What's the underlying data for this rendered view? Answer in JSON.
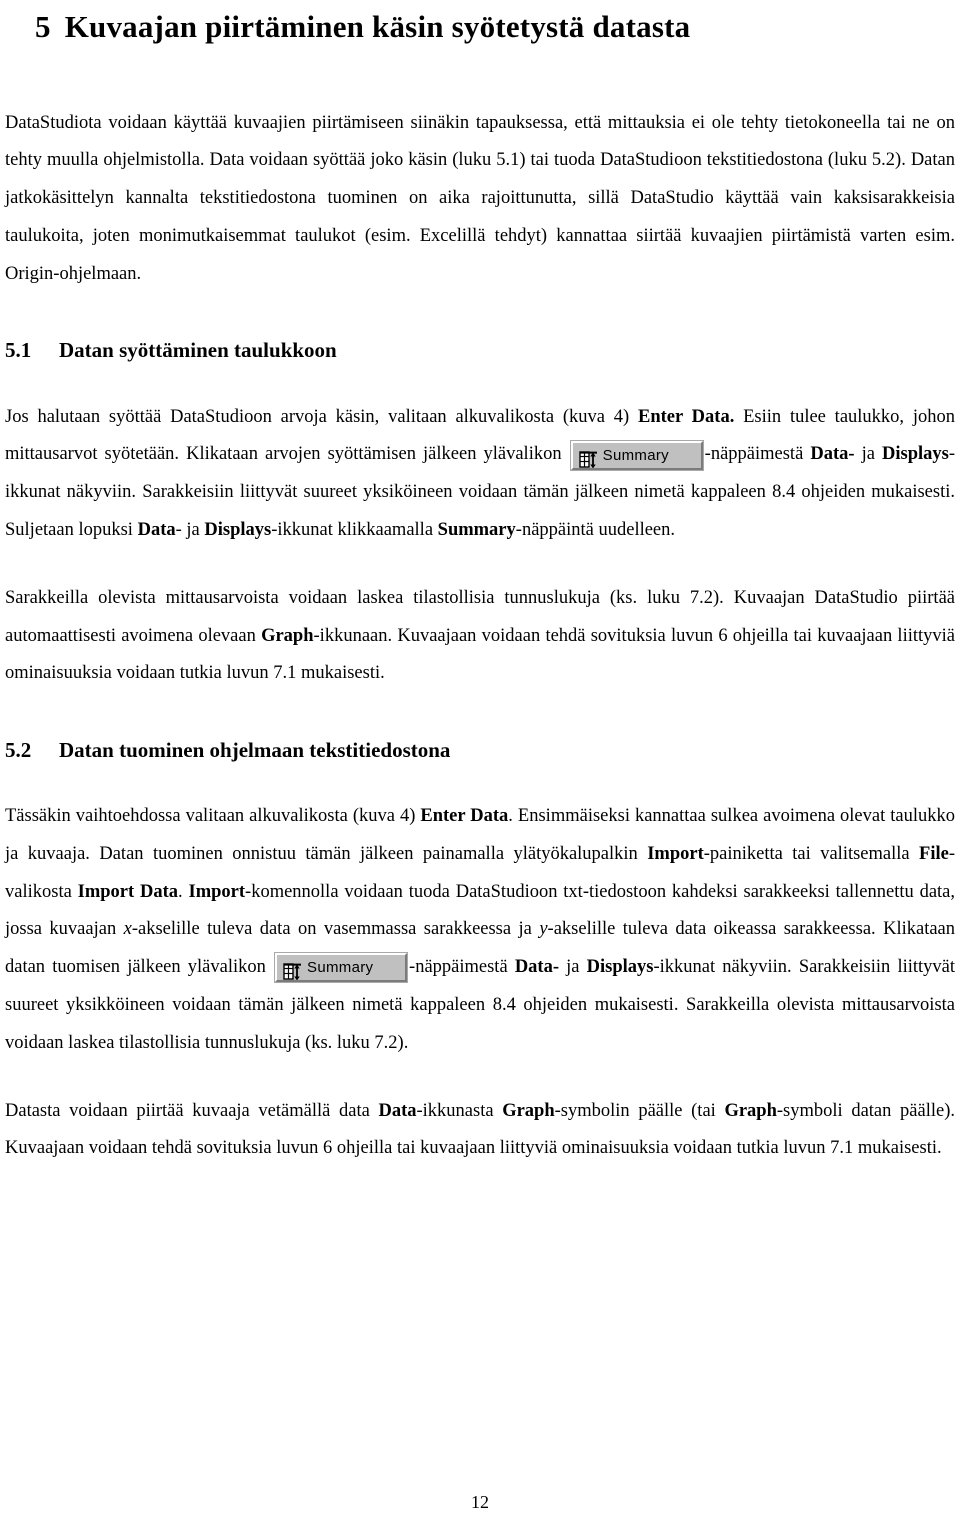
{
  "document": {
    "title": {
      "number": "5",
      "text": "Kuvaajan piirtäminen käsin syötetystä datasta"
    },
    "page_number": "12",
    "intro": {
      "p1_a": "DataStudiota voidaan käyttää kuvaajien piirtämiseen siinäkin tapauksessa, että mittauksia ei ole tehty tietokoneella tai ne on tehty muulla ohjelmistolla. Data voidaan syöttää joko käsin (luku 5.1) tai tuoda DataStudioon tekstitiedostona (luku 5.2). Datan jatkokäsittelyn kannalta tekstitiedostona tuominen on aika rajoittunutta, sillä DataStudio käyttää vain kaksisarakkeisia taulukoita, joten monimutkaisemmat taulukot (esim. Excelillä tehdyt) kannattaa siirtää kuvaajien piirtämistä varten esim. Origin-ohjelmaan."
    },
    "section_51": {
      "number": "5.1",
      "heading": "Datan syöttäminen taulukkoon",
      "p1_seg1": "Jos halutaan syöttää DataStudioon arvoja käsin, valitaan alkuvalikosta (kuva 4) ",
      "p1_bold1": "Enter Data.",
      "p1_seg2": " Esiin tulee taulukko, johon mittausarvot syötetään. Klikataan arvojen syöttämisen jälkeen ylävalikon ",
      "p1_seg3": "-näppäimestä ",
      "p1_bold2": "Data-",
      "p1_seg4": " ja ",
      "p1_bold3": "Displays",
      "p1_seg5": "-ikkunat näkyviin. Sarakkeisiin liittyvät suureet yksiköineen voidaan tämän jälkeen nimetä kappaleen 8.4 ohjeiden mukaisesti. Suljetaan lopuksi ",
      "p1_bold4": "Data",
      "p1_seg6": "- ja ",
      "p1_bold5": "Displays",
      "p1_seg7": "-ikkunat klikkaamalla ",
      "p1_bold6": "Summary",
      "p1_seg8": "-näppäintä uudelleen.",
      "p2_seg1": "Sarakkeilla olevista mittausarvoista voidaan laskea tilastollisia tunnuslukuja (ks. luku 7.2). Kuvaajan DataStudio piirtää automaattisesti avoimena olevaan ",
      "p2_bold1": "Graph",
      "p2_seg2": "-ikkunaan. Kuvaajaan voidaan tehdä sovituksia luvun 6 ohjeilla tai kuvaajaan liittyviä ominaisuuksia voidaan tutkia luvun 7.1 mukaisesti."
    },
    "section_52": {
      "number": "5.2",
      "heading": "Datan tuominen ohjelmaan tekstitiedostona",
      "p1_seg1": "Tässäkin vaihtoehdossa valitaan alkuvalikosta (kuva 4) ",
      "p1_bold1": "Enter Data",
      "p1_seg2": ". Ensimmäiseksi kannattaa sulkea avoimena olevat taulukko ja kuvaaja. Datan tuominen onnistuu tämän jälkeen painamalla ylätyökalupalkin ",
      "p1_bold2": "Import",
      "p1_seg3": "-painiketta tai valitsemalla ",
      "p1_bold3": "File",
      "p1_seg4": "-valikosta ",
      "p1_bold4": "Import Data",
      "p1_seg5": ". ",
      "p1_bold5": "Import",
      "p1_seg6": "-komennolla voidaan tuoda DataStudioon txt-tiedostoon kahdeksi sarakkeeksi tallennettu data, jossa kuvaajan ",
      "p1_italic1": "x",
      "p1_seg7": "-akselille tuleva data on vasemmassa sarakkeessa ja ",
      "p1_italic2": "y",
      "p1_seg8": "-akselille tuleva data oikeassa sarakkeessa. Klikataan datan tuomisen jälkeen ylävalikon ",
      "p1_seg9": "-näppäimestä ",
      "p1_bold6": "Data-",
      "p1_seg10": " ja ",
      "p1_bold7": "Displays",
      "p1_seg11": "-ikkunat näkyviin. Sarakkeisiin liittyvät suureet yksikköineen voidaan tämän jälkeen nimetä kappaleen 8.4 ohjeiden mukaisesti. Sarakkeilla olevista mittausarvoista voidaan laskea tilastollisia tunnuslukuja (ks. luku 7.2).",
      "p2_seg1": "Datasta voidaan piirtää kuvaaja vetämällä data ",
      "p2_bold1": "Data",
      "p2_seg2": "-ikkunasta ",
      "p2_bold2": "Graph",
      "p2_seg3": "-symbolin päälle (tai ",
      "p2_bold3": "Graph",
      "p2_seg4": "-symboli datan päälle). Kuvaajaan voidaan tehdä sovituksia luvun 6 ohjeilla tai kuvaajaan liittyviä ominaisuuksia voidaan tutkia luvun 7.1 mukaisesti."
    },
    "summary_button": {
      "label": "Summary",
      "icon": "table-resize-icon",
      "face_color": "#c0c0c0",
      "highlight_color": "#ffffff",
      "shadow_color": "#7b7b7b"
    }
  }
}
